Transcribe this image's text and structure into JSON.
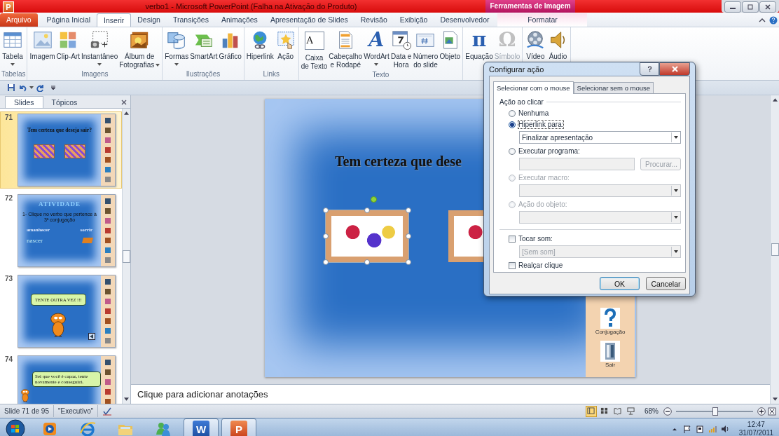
{
  "app_icon": {
    "letter": "P"
  },
  "window": {
    "title": "verbo1  -  Microsoft PowerPoint (Falha na Ativação do Produto)",
    "context_title": "Ferramentas de Imagem"
  },
  "tabs": [
    {
      "label": "Arquivo",
      "kind": "file",
      "selected": false
    },
    {
      "label": "Página Inicial",
      "kind": "tab",
      "selected": false
    },
    {
      "label": "Inserir",
      "kind": "tab",
      "selected": true
    },
    {
      "label": "Design",
      "kind": "tab",
      "selected": false
    },
    {
      "label": "Transições",
      "kind": "tab",
      "selected": false
    },
    {
      "label": "Animações",
      "kind": "tab",
      "selected": false
    },
    {
      "label": "Apresentação de Slides",
      "kind": "tab",
      "selected": false
    },
    {
      "label": "Revisão",
      "kind": "tab",
      "selected": false
    },
    {
      "label": "Exibição",
      "kind": "tab",
      "selected": false
    },
    {
      "label": "Desenvolvedor",
      "kind": "tab",
      "selected": false
    },
    {
      "label": "Formatar",
      "kind": "context",
      "selected": false
    }
  ],
  "ribbon_groups": [
    {
      "label": "Tabelas",
      "commands": [
        {
          "lines": [
            "Tabela"
          ],
          "dropdown": true,
          "disabled": false
        }
      ]
    },
    {
      "label": "Imagens",
      "commands": [
        {
          "lines": [
            "Imagem"
          ],
          "dropdown": false,
          "disabled": false
        },
        {
          "lines": [
            "Clip-Art"
          ],
          "dropdown": false,
          "disabled": false
        },
        {
          "lines": [
            "Instantâneo"
          ],
          "dropdown": true,
          "disabled": false
        },
        {
          "lines": [
            "Álbum de",
            "Fotografias"
          ],
          "dropdown": true,
          "disabled": false
        }
      ]
    },
    {
      "label": "Ilustrações",
      "commands": [
        {
          "lines": [
            "Formas"
          ],
          "dropdown": true,
          "disabled": false
        },
        {
          "lines": [
            "SmartArt"
          ],
          "dropdown": false,
          "disabled": false
        },
        {
          "lines": [
            "Gráfico"
          ],
          "dropdown": false,
          "disabled": false
        }
      ]
    },
    {
      "label": "Links",
      "commands": [
        {
          "lines": [
            "Hiperlink"
          ],
          "dropdown": false,
          "disabled": false
        },
        {
          "lines": [
            "Ação"
          ],
          "dropdown": false,
          "disabled": false
        }
      ]
    },
    {
      "label": "Texto",
      "commands": [
        {
          "lines": [
            "Caixa",
            "de Texto"
          ],
          "glyph": "A",
          "dropdown": false,
          "disabled": false
        },
        {
          "lines": [
            "Cabeçalho",
            "e Rodapé"
          ],
          "dropdown": false,
          "disabled": false
        },
        {
          "lines": [
            "WordArt"
          ],
          "glyph": "A",
          "dropdown": true,
          "disabled": false
        },
        {
          "lines": [
            "Data e",
            "Hora"
          ],
          "dropdown": false,
          "disabled": false
        },
        {
          "lines": [
            "Número",
            "do slide"
          ],
          "dropdown": false,
          "disabled": false
        },
        {
          "lines": [
            "Objeto"
          ],
          "dropdown": false,
          "disabled": false
        }
      ]
    },
    {
      "commands": [
        {
          "lines": [
            "Equação"
          ],
          "glyph": "π",
          "dropdown": false,
          "disabled": false
        },
        {
          "lines": [
            "Símbolo"
          ],
          "glyph": "Ω",
          "dropdown": false,
          "disabled": true
        }
      ]
    },
    {
      "commands": [
        {
          "lines": [
            "Vídeo"
          ],
          "dropdown": false,
          "disabled": false
        },
        {
          "lines": [
            "Áudio"
          ],
          "dropdown": false,
          "disabled": false
        }
      ]
    }
  ],
  "slide_pane": {
    "tabs": [
      {
        "label": "Slides",
        "selected": true
      },
      {
        "label": "Tópicos",
        "selected": false
      }
    ],
    "thumbnails": [
      {
        "number": "71",
        "selected": true,
        "kind": "question",
        "texts": [
          "Tem certeza  que deseja sair?"
        ]
      },
      {
        "number": "72",
        "selected": false,
        "kind": "activity",
        "texts": [
          "ATIVIDADE",
          "1- Clique no verbo que pertence à 3ª conjugação",
          "amanhecer",
          "sorrir",
          "nascer"
        ]
      },
      {
        "number": "73",
        "selected": false,
        "kind": "bubble",
        "texts": [
          "TENTE OUTRA VEZ !!!"
        ]
      },
      {
        "number": "74",
        "selected": false,
        "kind": "bubble_low",
        "texts": [
          "Sei que você é capaz, tente novamente e conseguirá."
        ]
      }
    ]
  },
  "slide": {
    "title": "Tem certeza que dese",
    "pictures": [
      {
        "kind": "sim",
        "selected": true
      },
      {
        "kind": "nao",
        "selected": false
      }
    ],
    "nav": [
      {
        "label": "Conjugação",
        "kind": "question"
      },
      {
        "label": "Sair",
        "kind": "door"
      }
    ]
  },
  "notes": {
    "text": "Clique para adicionar anotações"
  },
  "status_bar": {
    "slide": "Slide 71 de 95",
    "theme": "\"Executivo\"",
    "views": [
      {
        "kind": "normal",
        "selected": true
      },
      {
        "kind": "sorter",
        "selected": false
      },
      {
        "kind": "reading",
        "selected": false
      },
      {
        "kind": "show",
        "selected": false
      }
    ],
    "zoom": {
      "label": "68%",
      "level": 0.5
    }
  },
  "dialog": {
    "title": "Configurar ação",
    "tabs": [
      {
        "label": "Selecionar com o mouse",
        "selected": true
      },
      {
        "label": "Selecionar sem o mouse",
        "selected": false
      }
    ],
    "section_label": "Ação ao clicar",
    "rows": [
      {
        "kind": "radio",
        "label": "Nenhuma",
        "selected": false,
        "disabled": false
      },
      {
        "kind": "radio",
        "label": "Hiperlink para:",
        "selected": true,
        "disabled": false
      },
      {
        "kind": "select",
        "value": "Finalizar apresentação",
        "disabled": false
      },
      {
        "kind": "radio",
        "label": "Executar programa:",
        "selected": false,
        "disabled": false
      },
      {
        "kind": "path",
        "button": "Procurar...",
        "disabled": true
      },
      {
        "kind": "radio",
        "label": "Executar macro:",
        "selected": false,
        "disabled": true
      },
      {
        "kind": "select",
        "disabled": true
      },
      {
        "kind": "radio",
        "label": "Ação do objeto:",
        "selected": false,
        "disabled": true
      },
      {
        "kind": "select",
        "disabled": true
      },
      {
        "kind": "divider"
      },
      {
        "kind": "checkbox",
        "label": "Tocar som:",
        "checked": false,
        "disabled": false
      },
      {
        "kind": "select",
        "value": "[Sem som]",
        "disabled": true
      },
      {
        "kind": "checkbox",
        "label": "Realçar clique",
        "checked": false,
        "disabled": false
      }
    ],
    "buttons": [
      {
        "label": "OK",
        "default": true
      },
      {
        "label": "Cancelar",
        "default": false
      }
    ]
  },
  "taskbar": {
    "apps": [
      {
        "kind": "media",
        "running": false
      },
      {
        "kind": "browser",
        "running": false
      },
      {
        "kind": "folder",
        "running": false
      },
      {
        "kind": "messenger",
        "running": false
      },
      {
        "kind": "word",
        "letter": "W",
        "running": true
      },
      {
        "kind": "powerpoint",
        "letter": "P",
        "running": true
      }
    ],
    "time": "12:47",
    "date": "31/07/2011"
  }
}
